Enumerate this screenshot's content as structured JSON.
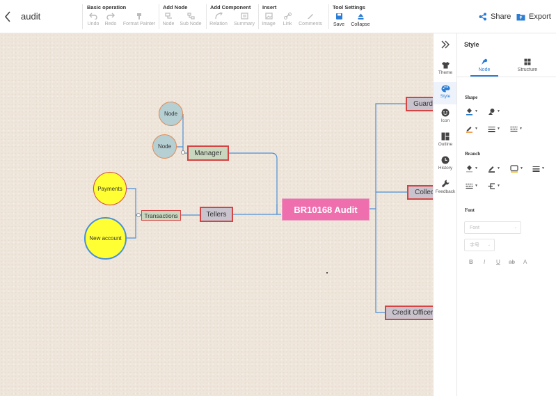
{
  "header": {
    "title": "audit",
    "share_label": "Share",
    "export_label": "Export"
  },
  "toolbar": {
    "groups": [
      {
        "title": "Basic operation",
        "tools": [
          "Undo",
          "Redo",
          "Format Painter"
        ]
      },
      {
        "title": "Add Node",
        "tools": [
          "Node",
          "Sub Node"
        ]
      },
      {
        "title": "Add Component",
        "tools": [
          "Relation",
          "Summary"
        ]
      },
      {
        "title": "Insert",
        "tools": [
          "Image",
          "Link",
          "Comments"
        ]
      },
      {
        "title": "Tool Settings",
        "tools": [
          "Save",
          "Collapse"
        ]
      }
    ]
  },
  "mindmap": {
    "root": "BR10168 Audit",
    "right_branches": [
      "Guard",
      "Collec",
      "Credit Officer"
    ],
    "left_branches": [
      "Manager",
      "Tellers"
    ],
    "manager_children": [
      "Node",
      "Node"
    ],
    "tellers_children": [
      "Transactions"
    ],
    "transactions_children": [
      "Payments",
      "New account"
    ]
  },
  "sidebar": {
    "items": [
      "Theme",
      "Style",
      "Icon",
      "Outline",
      "History",
      "Feedback"
    ],
    "active": "Style"
  },
  "panel": {
    "title": "Style",
    "tabs": [
      "Node",
      "Structure"
    ],
    "active_tab": "Node",
    "sections": {
      "shape": "Shape",
      "branch": "Branch",
      "font": "Font"
    },
    "font_family_placeholder": "Font",
    "font_size_placeholder": "字号",
    "format_buttons": [
      "B",
      "I",
      "U",
      "ab",
      "A"
    ]
  },
  "colors": {
    "root_fill": "#ef6fae",
    "node_fill": "#c9c3ce",
    "node_border": "#d64343",
    "manager_fill": "#c9d7bf",
    "circle_blue": "#b5cfd3",
    "circle_yellow": "#ffff33",
    "branch_line": "#4a90d9",
    "accent": "#2b7cd3",
    "canvas": "#efe6db"
  }
}
